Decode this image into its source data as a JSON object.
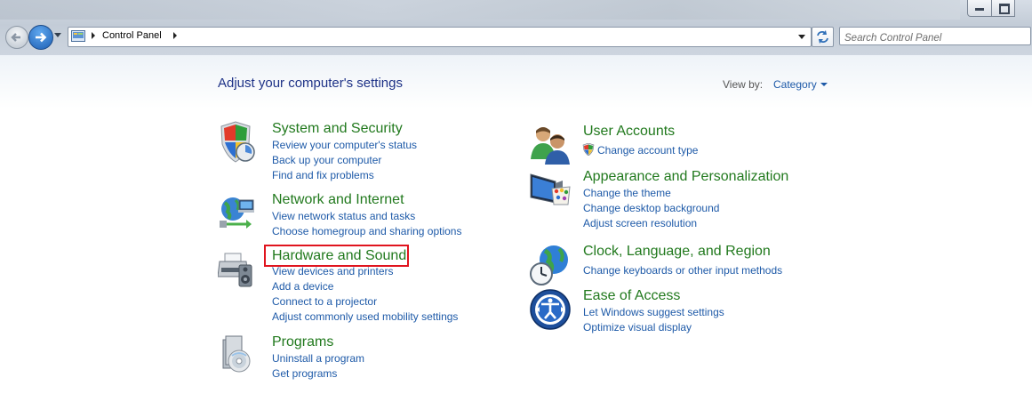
{
  "window": {
    "breadcrumb": "Control Panel",
    "search_placeholder": "Search Control Panel"
  },
  "heading": "Adjust your computer's settings",
  "view_by": {
    "label": "View by:",
    "value": "Category"
  },
  "categories_left": [
    {
      "title": "System and Security",
      "icon": "shield-icon",
      "links": [
        "Review your computer's status",
        "Back up your computer",
        "Find and fix problems"
      ]
    },
    {
      "title": "Network and Internet",
      "icon": "network-globe-icon",
      "links": [
        "View network status and tasks",
        "Choose homegroup and sharing options"
      ]
    },
    {
      "title": "Hardware and Sound",
      "icon": "printer-speaker-icon",
      "highlighted": true,
      "links": [
        "View devices and printers",
        "Add a device",
        "Connect to a projector",
        "Adjust commonly used mobility settings"
      ]
    },
    {
      "title": "Programs",
      "icon": "programs-disc-icon",
      "links": [
        "Uninstall a program",
        "Get programs"
      ]
    }
  ],
  "categories_right": [
    {
      "title": "User Accounts",
      "icon": "users-icon",
      "links": [
        "Change account type"
      ]
    },
    {
      "title": "Appearance and Personalization",
      "icon": "monitor-palette-icon",
      "links": [
        "Change the theme",
        "Change desktop background",
        "Adjust screen resolution"
      ]
    },
    {
      "title": "Clock, Language, and Region",
      "icon": "clock-globe-icon",
      "links": [
        "Change keyboards or other input methods"
      ]
    },
    {
      "title": "Ease of Access",
      "icon": "ease-of-access-icon",
      "links": [
        "Let Windows suggest settings",
        "Optimize visual display"
      ]
    }
  ],
  "colors": {
    "category_title": "#21791d",
    "link": "#1e5aa8",
    "heading": "#1e3287",
    "highlight": "#e0141e"
  }
}
